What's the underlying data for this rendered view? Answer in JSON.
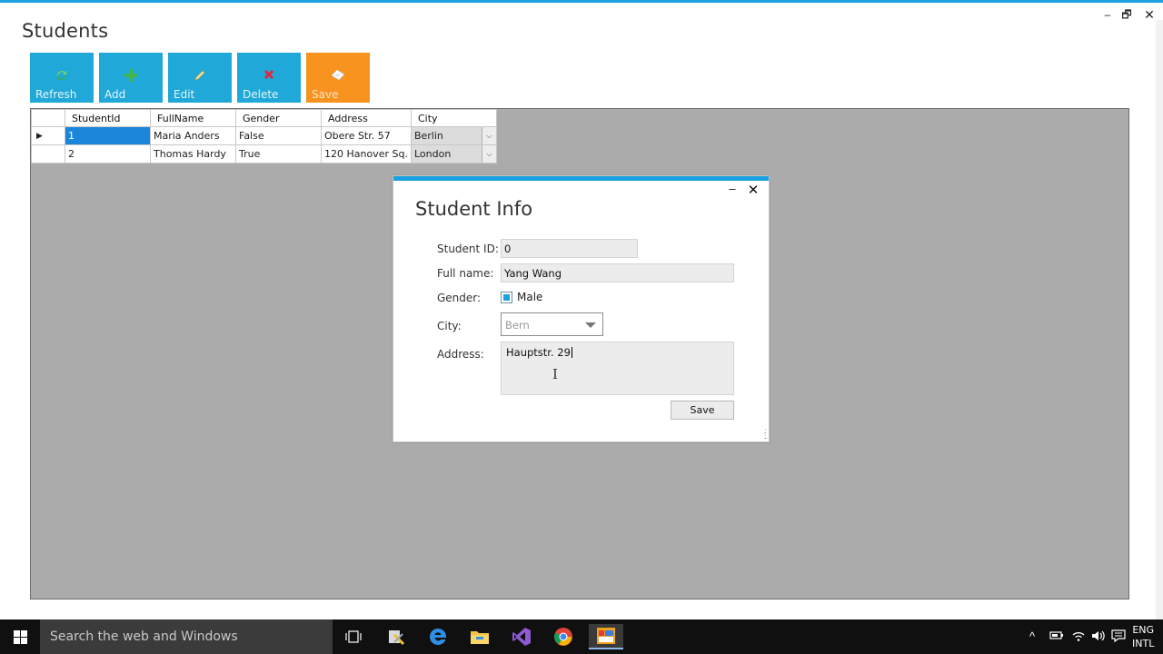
{
  "window": {
    "title": "Students",
    "minimize_glyph": "‒",
    "maximize_glyph": "🗗",
    "close_glyph": "✕"
  },
  "toolbar": [
    {
      "label": "Refresh",
      "icon": "refresh-icon",
      "color": "#1fa8d8"
    },
    {
      "label": "Add",
      "icon": "add-icon",
      "color": "#1fa8d8"
    },
    {
      "label": "Edit",
      "icon": "edit-icon",
      "color": "#1fa8d8"
    },
    {
      "label": "Delete",
      "icon": "delete-icon",
      "color": "#1fa8d8"
    },
    {
      "label": "Save",
      "icon": "save-icon",
      "color": "#f7931e"
    }
  ],
  "grid": {
    "columns": [
      "StudentId",
      "FullName",
      "Gender",
      "Address",
      "City"
    ],
    "rows": [
      {
        "id": "1",
        "name": "Maria Anders",
        "gender": "False",
        "address": "Obere Str. 57",
        "city": "Berlin"
      },
      {
        "id": "2",
        "name": "Thomas Hardy",
        "gender": "True",
        "address": "120 Hanover Sq.",
        "city": "London"
      }
    ],
    "current_row_marker": "▶"
  },
  "dialog": {
    "title": "Student Info",
    "minimize_glyph": "‒",
    "close_glyph": "✕",
    "labels": {
      "student_id": "Student ID:",
      "full_name": "Full name:",
      "gender": "Gender:",
      "city": "City:",
      "address": "Address:"
    },
    "values": {
      "student_id": "0",
      "full_name": "Yang Wang",
      "gender_checkbox_label": "Male",
      "gender_checked": true,
      "city": "Bern",
      "address": "Hauptstr. 29"
    },
    "save_label": "Save"
  },
  "taskbar": {
    "search_placeholder": "Search the web and Windows",
    "apps": [
      "task-view-icon",
      "file-tool-icon",
      "edge-icon",
      "file-explorer-icon",
      "visual-studio-icon",
      "chrome-icon",
      "running-app-icon"
    ],
    "lang_line1": "ENG",
    "lang_line2": "INTL"
  },
  "colors": {
    "accent": "#1ba1e2",
    "tile_blue": "#1fa8d8",
    "tile_orange": "#f7931e",
    "selection": "#1b86d9"
  }
}
